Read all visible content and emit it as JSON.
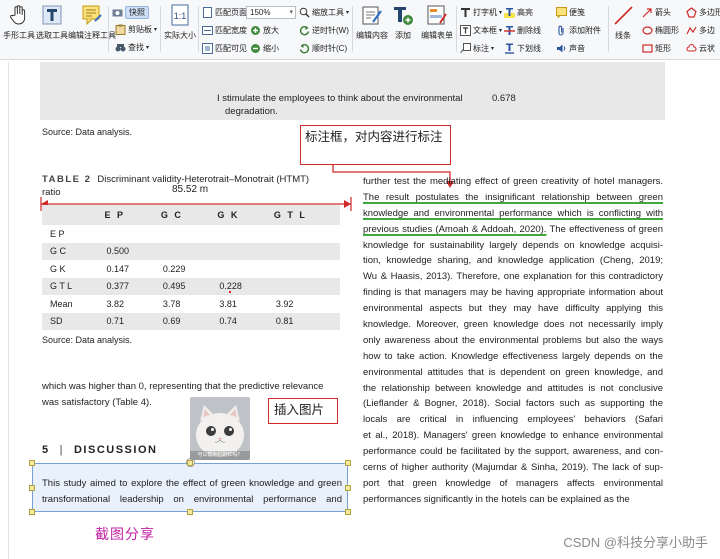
{
  "toolbar": {
    "hand_tool": "手形工具",
    "select_tool": "选取工具",
    "edit_annot_tool": "编辑注释工具",
    "snapshot": "快照",
    "clipboard": "剪贴板",
    "find": "查找",
    "actual_size": "实际大小",
    "fit_page": "匹配页面",
    "fit_width": "匹配宽度",
    "fit_visible": "匹配可见",
    "zoom_value": "150%",
    "zoom_tools": "缩放工具",
    "zoom_in": "放大",
    "zoom_out": "缩小",
    "rotate_ccw": "逆时针(W)",
    "rotate_cw": "顺时针(C)",
    "edit_content": "编辑内容",
    "add": "添加",
    "edit_form": "编辑表单",
    "typewriter": "打字机",
    "textbox": "文本框",
    "callout": "标注",
    "highlight": "高亮",
    "strikeout": "删除线",
    "underline": "下划线",
    "note": "便笺",
    "attach": "添加附件",
    "sound": "声音",
    "line": "线条",
    "arrow": "箭头",
    "ellipse": "椭圆形",
    "rectangle": "矩形",
    "polygon": "多边形",
    "polyline": "多边",
    "cloud": "云状"
  },
  "document": {
    "prev_row_text_1": "I stimulate the employees to think about the environmental",
    "prev_row_text_2": "degradation.",
    "prev_row_value": "0.678",
    "source_1": "Source: Data analysis.",
    "table_label": "TABLE 2",
    "table_title": "Discriminant validity-Heterotrait–Monotrait (HTMT)",
    "table_title_2": "ratio",
    "measure_label": "85.52 m",
    "table": {
      "headers": [
        "",
        "E P",
        "G C",
        "G K",
        "G T L"
      ],
      "rows": [
        [
          "E P",
          "",
          "",
          "",
          ""
        ],
        [
          "G C",
          "0.500",
          "",
          "",
          ""
        ],
        [
          "G K",
          "0.147",
          "0.229",
          "",
          ""
        ],
        [
          "G T L",
          "0.377",
          "0.495",
          "0.228",
          ""
        ],
        [
          "Mean",
          "3.82",
          "3.78",
          "3.81",
          "3.92"
        ],
        [
          "SD",
          "0.71",
          "0.69",
          "0.74",
          "0.81"
        ]
      ]
    },
    "source_2": "Source: Data analysis.",
    "left_para_1": "which was higher than 0, representing that the predictive relevance",
    "left_para_2": "was satisfactory (Table 4).",
    "section_num": "5",
    "section_bar": "|",
    "section_title": "DISCUSSION",
    "selected_text_1": "This study aimed to explore the effect of green knowledge and green",
    "selected_text_2": "transformational leadership on environmental performance and",
    "cat_caption": "可以帮你们的忙吗？",
    "right_column": [
      "further test the mediating effect of green creativity of hotel managers.",
      "The result postulates the insignificant relationship between green",
      "knowledge and environmental performance which is conflicting with",
      "previous studies (Amoah & Addoah, 2020). The effectiveness of green",
      "knowledge for sustainability largely depends on knowledge acquisi-",
      "tion, knowledge sharing, and knowledge application (Cheng, 2019;",
      "Wu & Haasis, 2013). Therefore, one explanation for this contradictory",
      "finding is that managers may be having appropriate information about",
      "environmental aspects but they may have difficulty applying this",
      "knowledge. Moreover, green knowledge does not necessarily imply",
      "only awareness about the environmental problems but also the ways",
      "how to take action. Knowledge effectiveness largely depends on the",
      "environmental attitudes that is dependent on green knowledge, and",
      "the relationship between knowledge and attitudes is not conclusive",
      "(Lieflander & Bogner, 2018). Social factors such as supporting the",
      "locals are critical in influencing employees' behaviors (Safari",
      "et al., 2018). Managers' green knowledge to enhance environmental",
      "performance could be facilitated by the support, awareness, and con-",
      "cerns of higher authority (Majumdar & Sinha, 2019). The lack of sup-",
      "port that green knowledge of managers affects environmental",
      "performances significantly in the hotels can be explained as the"
    ],
    "highlight_a": "The result postulates the insignificant relationship between green",
    "highlight_b": "knowledge and environmental performance which is conflicting with",
    "highlight_c": "previous studies (Amoah & Addoah, 2020).",
    "highlight_c_rest": " The effectiveness of green"
  },
  "annotations": {
    "callout_text": "标注框，对内容进行标注",
    "insert_image_label": "插入图片",
    "screenshot_label": "截图分享"
  },
  "watermark": "CSDN @科技分享小助手",
  "colors": {
    "callout_border": "#d12a2a",
    "highlight_underline": "#3fa93b",
    "screenshot_label": "#c21fa0",
    "table_band": "#e8e8e8"
  }
}
